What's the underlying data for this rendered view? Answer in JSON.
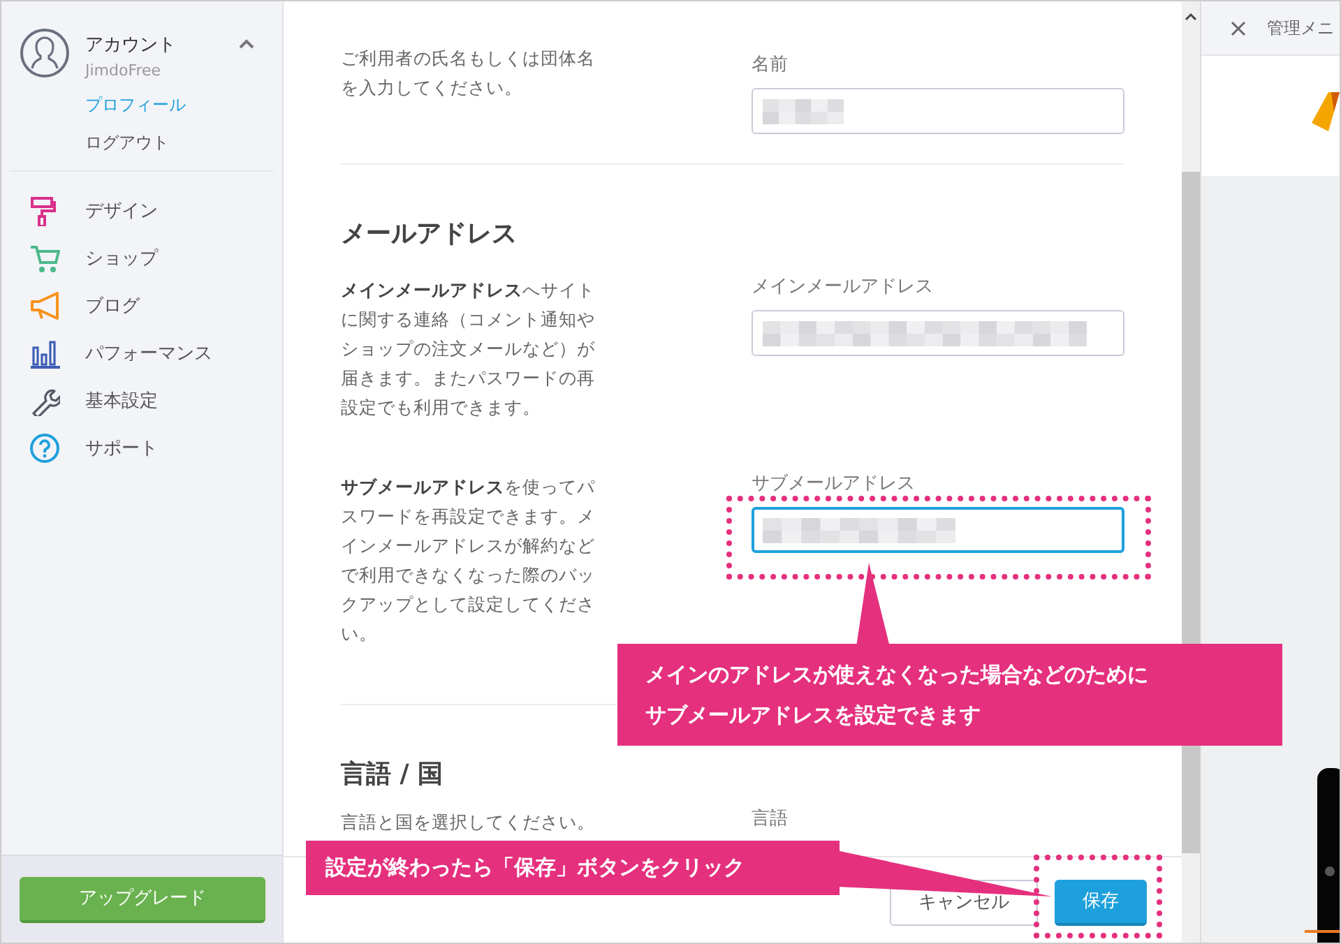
{
  "sidebar": {
    "account": {
      "title": "アカウント",
      "subtitle": "JimdoFree",
      "expanded": true
    },
    "sub_items": [
      {
        "label": "プロフィール",
        "selected": true
      },
      {
        "label": "ログアウト",
        "selected": false
      }
    ],
    "items": [
      {
        "label": "デザイン",
        "kind": "design"
      },
      {
        "label": "ショップ",
        "kind": "shop"
      },
      {
        "label": "ブログ",
        "kind": "blog"
      },
      {
        "label": "パフォーマンス",
        "kind": "performance"
      },
      {
        "label": "基本設定",
        "kind": "settings"
      },
      {
        "label": "サポート",
        "kind": "support"
      }
    ],
    "upgrade_button": "アップグレード"
  },
  "main": {
    "name_section": {
      "description": "ご利用者の氏名もしくは団体名を入力してください。",
      "field_label": "名前"
    },
    "email_section": {
      "heading": "メールアドレス",
      "rows": [
        {
          "description": "**メインメールアドレス**へサイトに関する連絡（コメント通知やショップの注文メールなど）が届きます。またパスワードの再設定でも利用できます。",
          "field_label": "メインメールアドレス",
          "focused": false
        },
        {
          "description": "**サブメールアドレス**を使ってパスワードを再設定できます。メインメールアドレスが解約などで利用できなくなった際のバックアップとして設定してください。",
          "field_label": "サブメールアドレス",
          "focused": true
        }
      ]
    },
    "language_section": {
      "heading": "言語 / 国",
      "description": "言語と国を選択してください。",
      "field_label": "言語"
    },
    "footer": {
      "cancel_button": "キャンセル",
      "save_button": "保存"
    }
  },
  "callouts": [
    {
      "lines": [
        "メインのアドレスが使えなくなった場合などのために",
        "サブメールアドレスを設定できます"
      ]
    },
    {
      "lines": [
        "設定が終わったら「保存」ボタンをクリック"
      ]
    }
  ],
  "right_panel": {
    "title": "管理メニ"
  }
}
